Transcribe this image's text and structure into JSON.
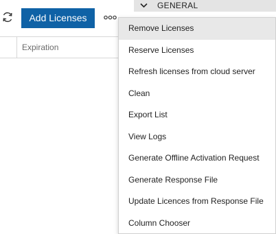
{
  "toolbar": {
    "refresh_icon": "refresh-icon",
    "add_label": "Add Licenses",
    "more_icon": "more-horizontal-icon",
    "accent": "#0f62a6"
  },
  "section": {
    "chevron_icon": "chevron-down-icon",
    "label": "GENERAL"
  },
  "table": {
    "columns": [
      "Expiration"
    ]
  },
  "menu": {
    "items": [
      {
        "label": "Remove Licenses",
        "active": true
      },
      {
        "label": "Reserve Licenses"
      },
      {
        "label": "Refresh licenses from cloud server"
      },
      {
        "label": "Clean"
      },
      {
        "label": "Export List"
      },
      {
        "label": "View Logs"
      },
      {
        "label": "Generate Offline Activation Request"
      },
      {
        "label": "Generate Response File"
      },
      {
        "label": "Update Licences from Response File"
      },
      {
        "label": "Column Chooser"
      }
    ]
  }
}
